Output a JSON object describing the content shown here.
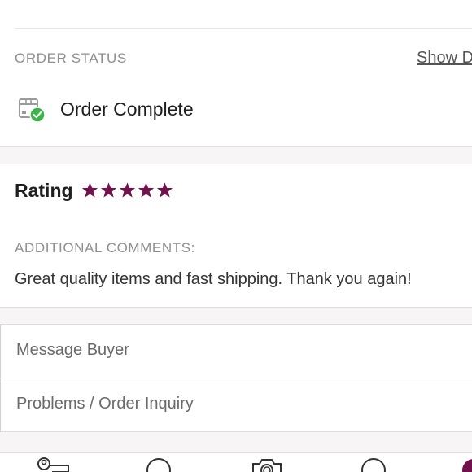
{
  "order_status": {
    "label": "ORDER STATUS",
    "show_details": "Show D",
    "status_text": "Order Complete",
    "status_icon": "package-check-icon"
  },
  "rating": {
    "title": "Rating",
    "stars": 5,
    "max_stars": 5,
    "star_color": "#72124d"
  },
  "comments": {
    "label": "ADDITIONAL COMMENTS:",
    "text": "Great quality items and fast shipping. Thank you again!"
  },
  "actions": {
    "message_buyer": "Message Buyer",
    "problems": "Problems / Order Inquiry"
  },
  "tabbar": {
    "icons": [
      "closet-icon",
      "search-icon",
      "camera-icon",
      "chat-icon",
      "profile-icon"
    ]
  },
  "colors": {
    "accent": "#72124d",
    "success": "#3cb24a"
  }
}
